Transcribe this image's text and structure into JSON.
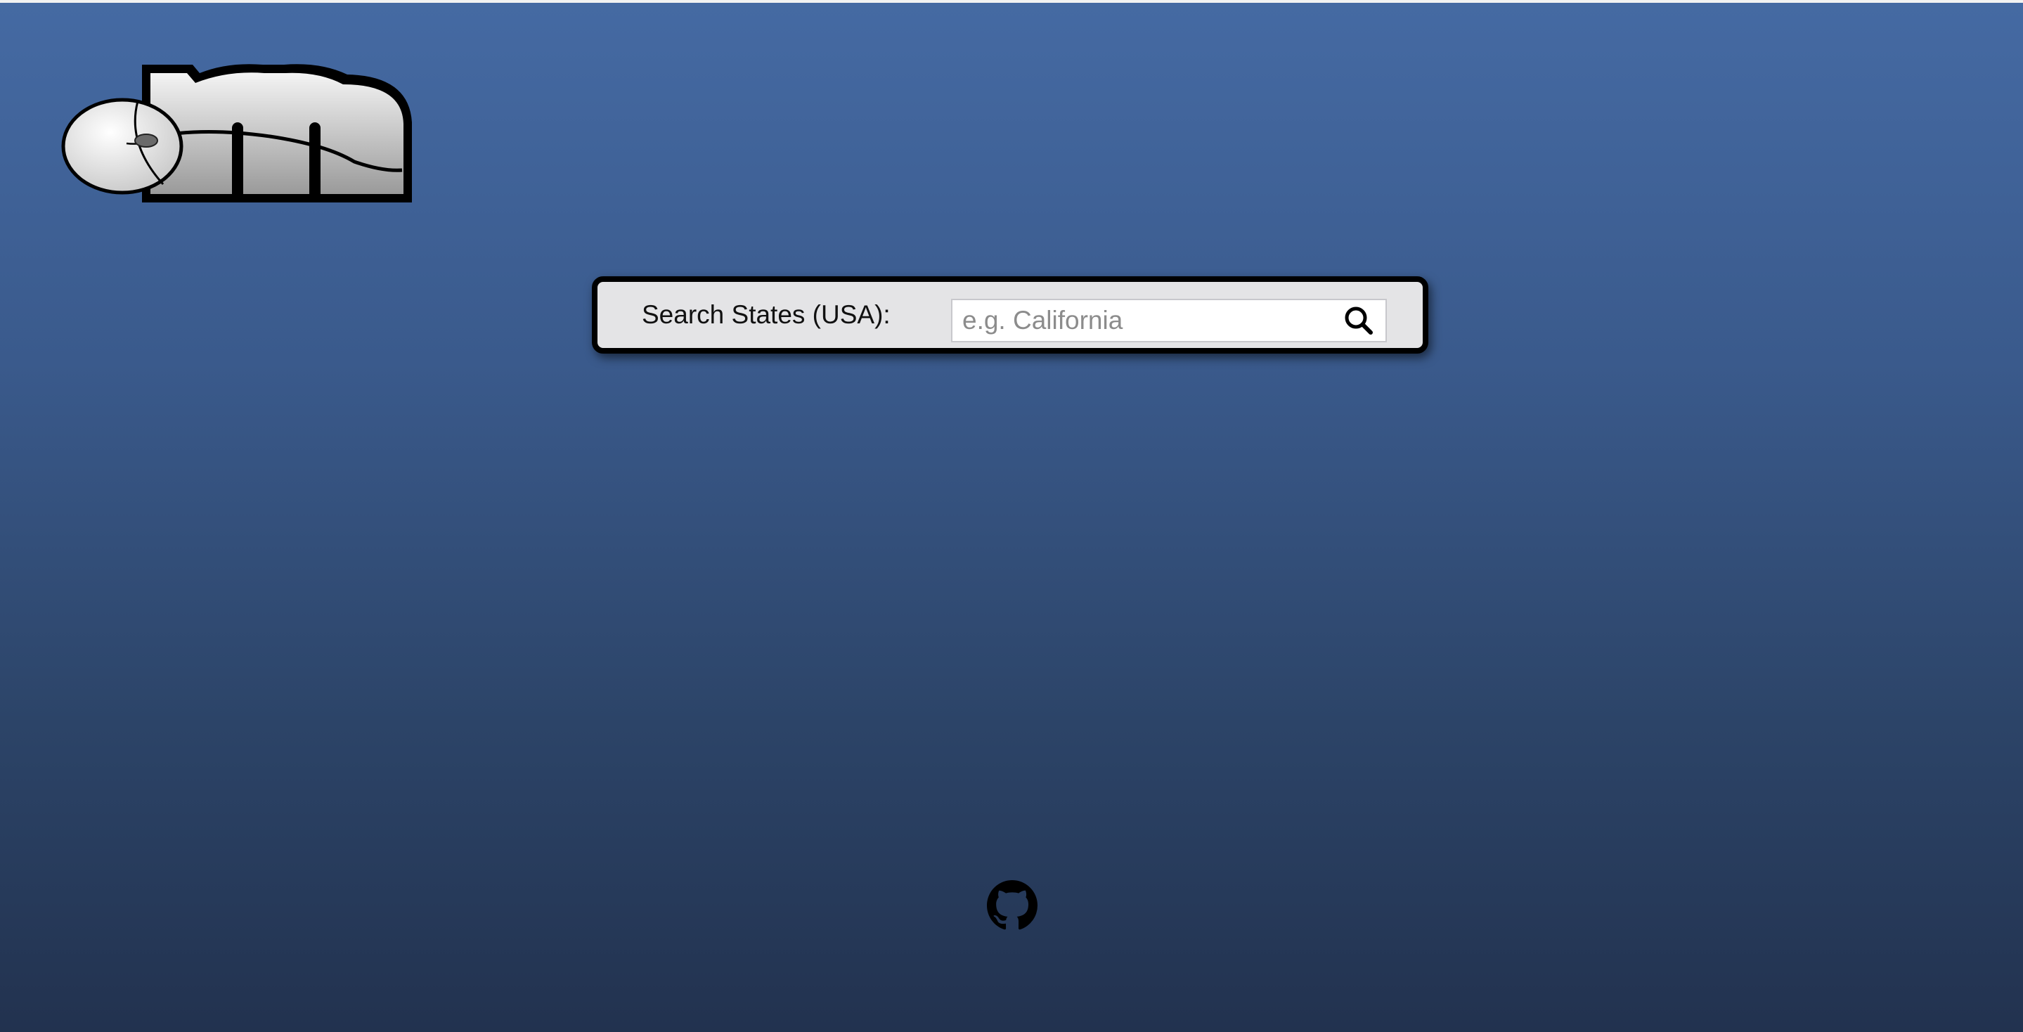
{
  "search": {
    "label": "Search States (USA):",
    "placeholder": "e.g. California",
    "value": ""
  },
  "icons": {
    "logo": "mouse-m-logo",
    "search_button": "search-icon",
    "footer_link": "github-icon"
  },
  "colors": {
    "background_top": "#456aa3",
    "background_bottom": "#22324f",
    "panel_background": "#e4e4e6",
    "panel_border": "#000000"
  }
}
